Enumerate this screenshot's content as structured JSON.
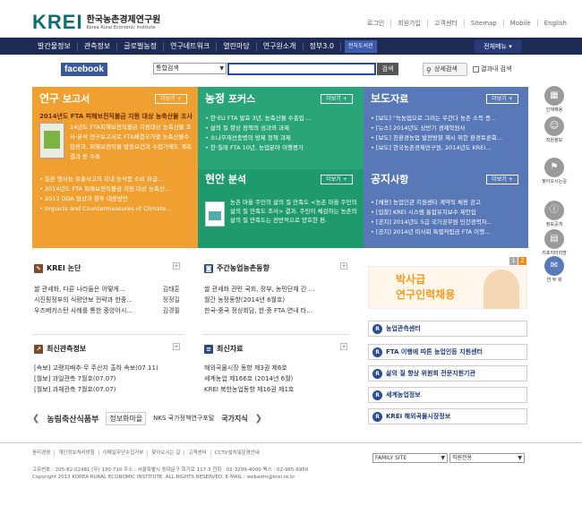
{
  "header": {
    "logo_mark": "KREI",
    "logo_title": "한국농촌경제연구원",
    "logo_subtitle": "Korea Rural Economic Institute",
    "links": [
      "로그인",
      "회원가입",
      "고객센터",
      "Sitemap",
      "Mobile",
      "English"
    ]
  },
  "nav": {
    "items": [
      "발간물정보",
      "관측정보",
      "글로벌농정",
      "연구네트워크",
      "열린마당",
      "연구원소개",
      "정부3.0"
    ],
    "library": "전자도서관",
    "all_menu": "전체메뉴"
  },
  "search": {
    "facebook": "facebook",
    "select_value": "통합검색",
    "button": "검색",
    "detail": "상세검색",
    "within": "결과내 검색"
  },
  "panels": {
    "research": {
      "title_hl": "연구",
      "title_rest": " 보고서",
      "more": "더보기 +",
      "featured": "2014년도 FTA 피해보전직불금 지원 대상 농축산물 조사",
      "featured_desc": "14년도 FTA피해보전직불금 지원대상 농축산물 조사·분석 연구보고서로 FTA체결국가별 농축산물수입량과, 피해보전직불 발동요건과 수입가에도 계측결과 등 수록",
      "items": [
        "일본 행사농 유출사고의 국내 농식품 소비 파급...",
        "2014년도 FTA 피해보전직불금 지원 대상 농축산...",
        "2013 DDA 협상과 향후 대응방안",
        "Impacts and Countermeasures of Climate..."
      ]
    },
    "focus": {
      "title_hl": "농정",
      "title_rest": " 포커스",
      "more": "더보기 +",
      "items": [
        "한·EU FTA 발효 3년, 농축산물 수출입 ...",
        "삶의 질 향상 정책의 성과와 과제",
        "소나무재선충병의 방제 정책 과제",
        "한·칠레 FTA 10년, 농업분야 이행평가"
      ]
    },
    "field": {
      "title_hl": "현안",
      "title_rest": " 분석",
      "more": "더보기 +",
      "desc": "농촌 마을 주민의 삶의 질 만족도 <농촌 마을 주민의 삶의 질 만족도 조사> 결과, 주민이 체감하는 농촌의 삶의 질 만족도는 전반적으로 양호한 편."
    },
    "press": {
      "title_hl": "보도",
      "title_rest": "자료",
      "more": "더보기 +",
      "items": [
        "[보도] \"녹농업으로 그리는 우간다 농촌 소득 증...",
        "[뉴스] 2014년도 상반기 경제학원사",
        "[보도] 친환경농업 발전방향 제시 위한 환경토론회...",
        "[보도] 한국농촌경제연구원, 2014년도 KREI..."
      ]
    },
    "notice": {
      "title_hl": "공지",
      "title_rest": "사항",
      "more": "더보기 +",
      "items": [
        "[채용] 농업인관 지원센터 계약직 채용 공고",
        "[입찰] KREI 시스템 통합유지보수 제안집",
        "[공지] 2014년도 5급 국가공무원 민간경력자...",
        "[공지] 2014년 미사회 특별적립금 FTA 이행..."
      ]
    }
  },
  "quick": [
    "인재채용",
    "직원정보",
    "찾아오시는길",
    "정보공개",
    "리포지터리방",
    "연 무 회"
  ],
  "quick_top": "TOP",
  "lower": {
    "column": {
      "title": "KREI 논단",
      "rows": [
        {
          "t": "쌀 관세화, 다른 나라들은 어떻게...",
          "a": "김태훈"
        },
        {
          "t": "시진핑정부의 식량안보 전략과 한중...",
          "a": "정정길"
        },
        {
          "t": "우즈베키스탄 사례를 통한 중앙아시...",
          "a": "김경필"
        }
      ]
    },
    "weekly": {
      "title": "주간농업농촌동향",
      "rows": [
        "쌀 관세화 관련 국회, 정부, 농민단체 간 ...",
        "월간 농정동향(2014년 6월호)",
        "한국-중국 정상회담, 한·중 FTA 연내 타..."
      ]
    },
    "obs": {
      "title": "최신관측정보",
      "rows": [
        "[속보] 고랭지배추·무 주산지 출하 속보(07.11)",
        "[월보] 과일관측 7월호(07.07)",
        "[월보] 과채관측 7월호(07.07)"
      ]
    },
    "latest": {
      "title": "최신자료",
      "rows": [
        "해외곡물시장 동향 제3권 제6호",
        "세계농업 제166호 (2014년 6월)",
        "KREI 북한농업동향 제16권 제1호"
      ]
    }
  },
  "banner": {
    "pages": [
      "1",
      "2"
    ],
    "line1": "박사급",
    "line2": "연구인력채용"
  },
  "quick_buttons": [
    "농업관측센터",
    "FTA 이행에 따른 농업인등 지원센터",
    "삶의 질 향상 위원회 전문지원기관",
    "세계농업정보",
    "KREI 해외곡물시장정보"
  ],
  "partners": [
    "농림축산식품부",
    "정보화마을",
    "NKS 국가정책연구포털",
    "국가지식"
  ],
  "footer": {
    "links": [
      "윤리경영",
      "개인정보처리방침",
      "이메일무단수집거부",
      "찾아오시는 길",
      "고객센터",
      "CCTV설치및운영안내"
    ],
    "family_site": "FAMILY SITE",
    "staff": "직원전용",
    "address": "고유번호 : 205-82-02481 (우) 130-710 주소 : 서울특별시 동대문구 회기로 117-3 전화 : 02-3299-4000 팩스 : 02-965-6950",
    "copyright": "Copyright 2013 KOREA RURAL ECONOMIC INSTITUTE.  ALL RIGHTS RESERVED.   E-MAIL : webadm@krei.re.kr"
  }
}
